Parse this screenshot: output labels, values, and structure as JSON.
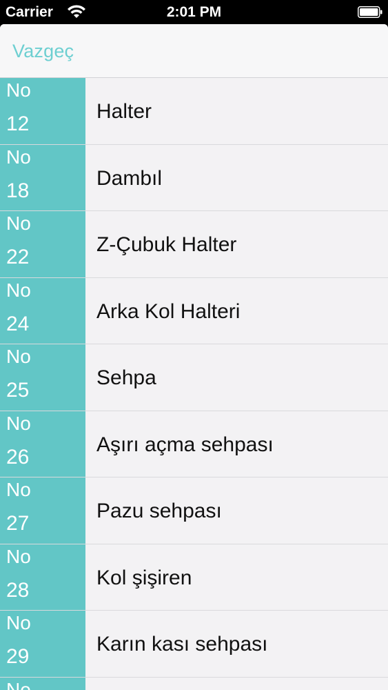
{
  "status_bar": {
    "carrier": "Carrier",
    "time": "2:01 PM"
  },
  "nav": {
    "cancel_label": "Vazgeç"
  },
  "colors": {
    "accent": "#6dcfd1",
    "badge": "#62c6c6",
    "row_bg": "#f3f2f4"
  },
  "items": [
    {
      "no_label": "No",
      "number": "12",
      "title": "Halter"
    },
    {
      "no_label": "No",
      "number": "18",
      "title": "Dambıl"
    },
    {
      "no_label": "No",
      "number": "22",
      "title": "Z-Çubuk Halter"
    },
    {
      "no_label": "No",
      "number": "24",
      "title": "Arka Kol Halteri"
    },
    {
      "no_label": "No",
      "number": "25",
      "title": "Sehpa"
    },
    {
      "no_label": "No",
      "number": "26",
      "title": "Aşırı açma sehpası"
    },
    {
      "no_label": "No",
      "number": "27",
      "title": "Pazu sehpası"
    },
    {
      "no_label": "No",
      "number": "28",
      "title": "Kol şişiren"
    },
    {
      "no_label": "No",
      "number": "29",
      "title": "Karın kası sehpası"
    }
  ],
  "partial_item": {
    "no_label": "No"
  }
}
